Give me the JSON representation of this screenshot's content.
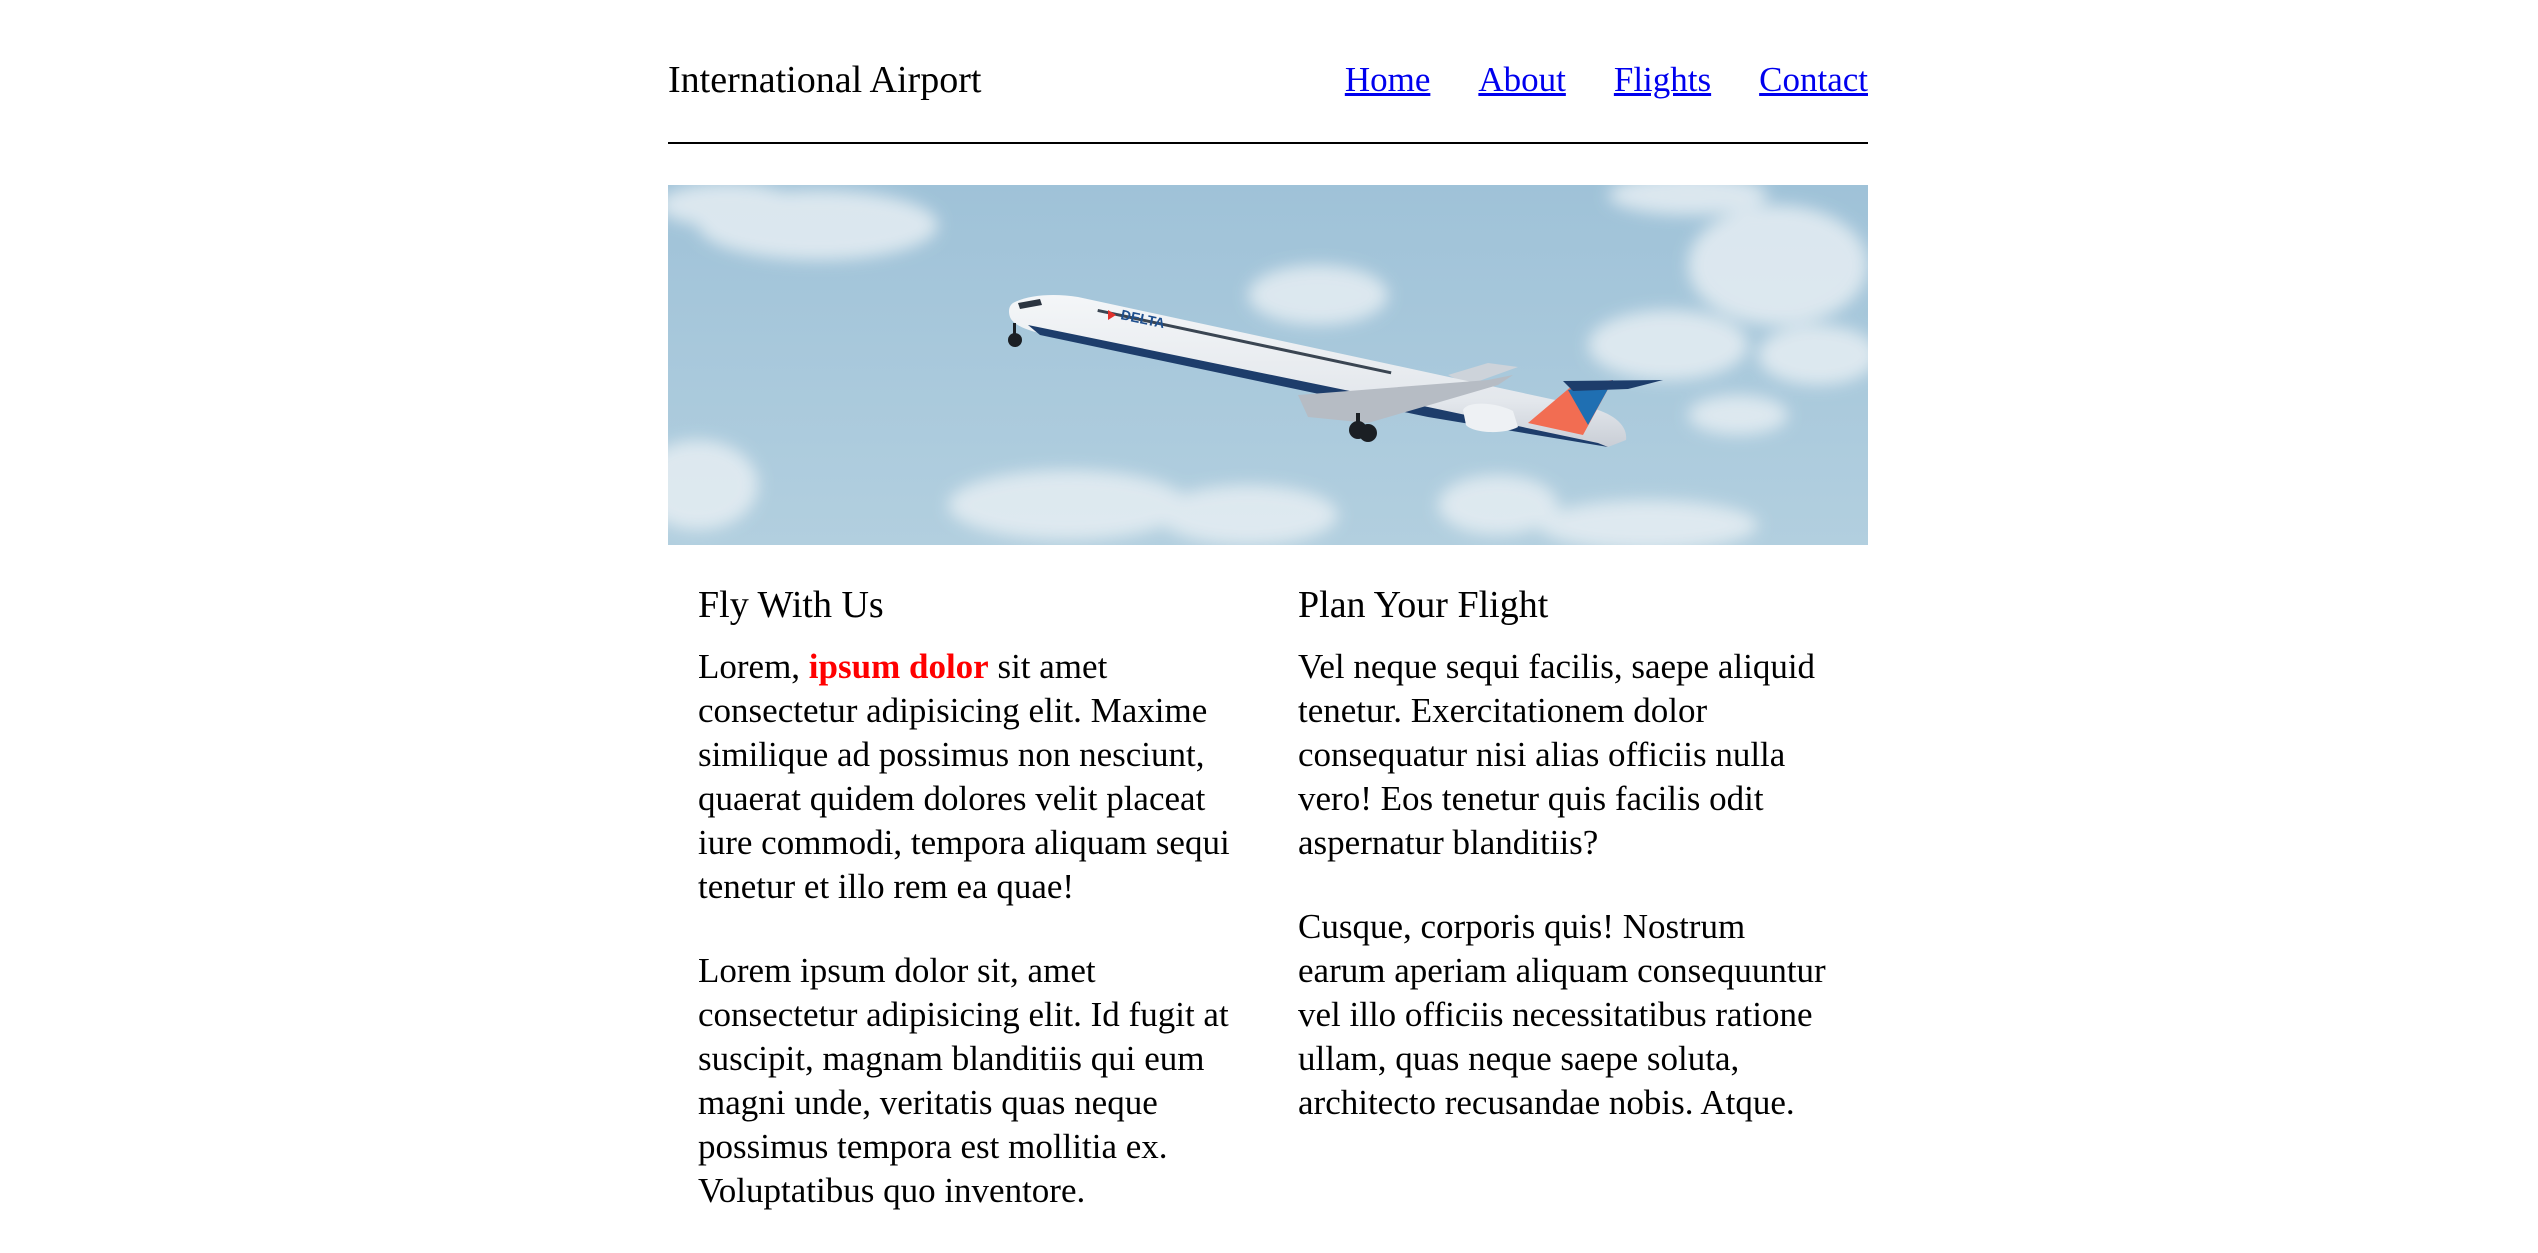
{
  "header": {
    "brand": "International Airport",
    "nav": [
      "Home",
      "About",
      "Flights",
      "Contact"
    ]
  },
  "hero": {
    "alt": "Delta airplane taking off in blue sky",
    "livery_text": "DELTA"
  },
  "columns": [
    {
      "title": "Fly With Us",
      "p1_before": "Lorem, ",
      "p1_highlight": "ipsum dolor",
      "p1_after": " sit amet consectetur adipisicing elit. Maxime similique ad possimus non nesciunt, quaerat quidem dolores velit placeat iure commodi, tempora aliquam sequi tenetur et illo rem ea quae!",
      "p2": "Lorem ipsum dolor sit, amet consectetur adipisicing elit. Id fugit at suscipit, magnam blanditiis qui eum magni unde, veritatis quas neque possimus tempora est mollitia ex. Voluptatibus quo inventore."
    },
    {
      "title": "Plan Your Flight",
      "p1": "Vel neque sequi facilis, saepe aliquid tenetur. Exercitationem dolor consequatur nisi alias officiis nulla vero! Eos tenetur quis facilis odit aspernatur blanditiis?",
      "p2": "Cusque, corporis quis! Nostrum earum aperiam aliquam consequuntur vel illo officiis necessitatibus ratione ullam, quas neque saepe soluta, architecto recusandae nobis. Atque."
    }
  ],
  "colors": {
    "link": "#0000ee",
    "highlight": "#ff0000",
    "sky": "#a3c4d8"
  }
}
